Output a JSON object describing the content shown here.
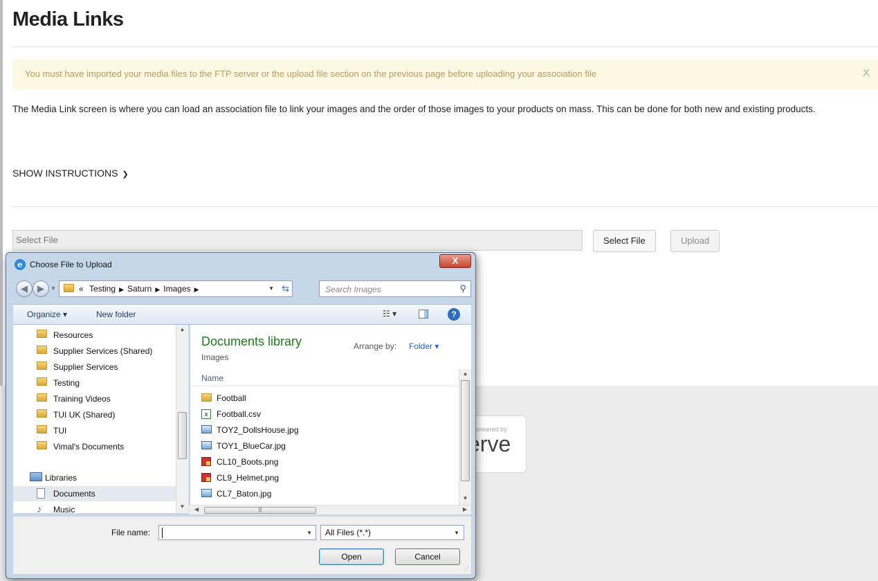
{
  "page": {
    "title": "Media Links",
    "notice": "You must have imported your media files to the FTP server or the upload file section on the previous page before uploading your association file",
    "notice_close": "X",
    "intro": "The Media Link screen is where you can load an association file to link your images and the order of those images to your products on mass. This can be done for both new and existing products.",
    "show_instructions": "SHOW INSTRUCTIONS",
    "chevron_icon": "chevron-down-icon",
    "file_placeholder": "Select File",
    "select_file_button": "Select File",
    "upload_button": "Upload",
    "powered_by": "powered by",
    "powered_brand": "erve"
  },
  "dialog": {
    "title": "Choose File to Upload",
    "close_glyph": "X",
    "breadcrumb": {
      "prefix": "«",
      "parts": [
        "Testing",
        "Saturn",
        "Images"
      ]
    },
    "search_placeholder": "Search Images",
    "toolbar": {
      "organize": "Organize ▾",
      "new_folder": "New folder",
      "views": "☷ ▾",
      "help": "?"
    },
    "nav_items": [
      {
        "label": "Resources",
        "icon": "folder-icon"
      },
      {
        "label": "Supplier Services (Shared)",
        "icon": "folder-icon"
      },
      {
        "label": "Supplier Services",
        "icon": "folder-icon"
      },
      {
        "label": "Testing",
        "icon": "folder-icon"
      },
      {
        "label": "Training Videos",
        "icon": "folder-icon"
      },
      {
        "label": "TUI UK (Shared)",
        "icon": "folder-icon"
      },
      {
        "label": "TUI",
        "icon": "folder-icon"
      },
      {
        "label": "Vimal's Documents",
        "icon": "folder-icon"
      },
      {
        "label": "Libraries",
        "icon": "libraries-icon"
      },
      {
        "label": "Documents",
        "icon": "document-icon"
      },
      {
        "label": "Music",
        "icon": "music-icon"
      }
    ],
    "library_title": "Documents library",
    "library_subtitle": "Images",
    "arrange_by_label": "Arrange by:",
    "arrange_by_value": "Folder ▾",
    "column_name": "Name",
    "files": [
      {
        "name": "Football",
        "icon": "folder-icon"
      },
      {
        "name": "Football.csv",
        "icon": "csv-icon"
      },
      {
        "name": "TOY2_DollsHouse.jpg",
        "icon": "image-icon"
      },
      {
        "name": "TOY1_BlueCar.jpg",
        "icon": "image-icon"
      },
      {
        "name": "CL10_Boots.png",
        "icon": "png-icon"
      },
      {
        "name": "CL9_Helmet.png",
        "icon": "png-icon"
      },
      {
        "name": "CL7_Baton.jpg",
        "icon": "image-icon"
      }
    ],
    "file_name_label": "File name:",
    "file_name_value": "",
    "file_type": "All Files (*.*)",
    "open_button": "Open",
    "cancel_button": "Cancel"
  }
}
